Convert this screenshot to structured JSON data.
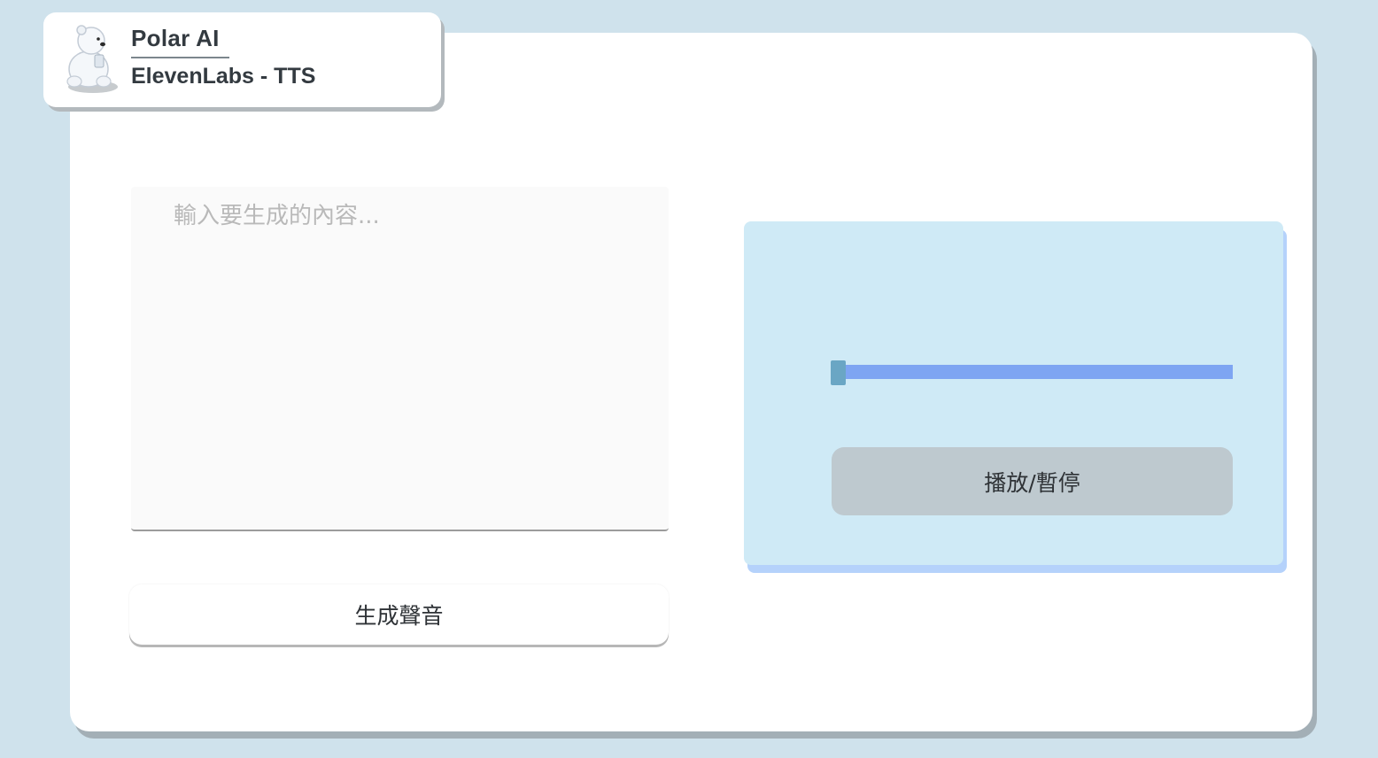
{
  "header": {
    "title": "Polar AI",
    "subtitle": "ElevenLabs - TTS",
    "logo_icon": "polar-bear-icon"
  },
  "input": {
    "placeholder": "輸入要生成的內容...",
    "value": ""
  },
  "generate_button": {
    "label": "生成聲音"
  },
  "player": {
    "progress": 0,
    "play_pause_label": "播放/暫停"
  },
  "colors": {
    "background": "#cfe2ec",
    "player_panel": "#cfeaf6",
    "slider_track": "#7ea5f2",
    "slider_thumb": "#6aa6c4",
    "play_button": "#bec9cf"
  }
}
